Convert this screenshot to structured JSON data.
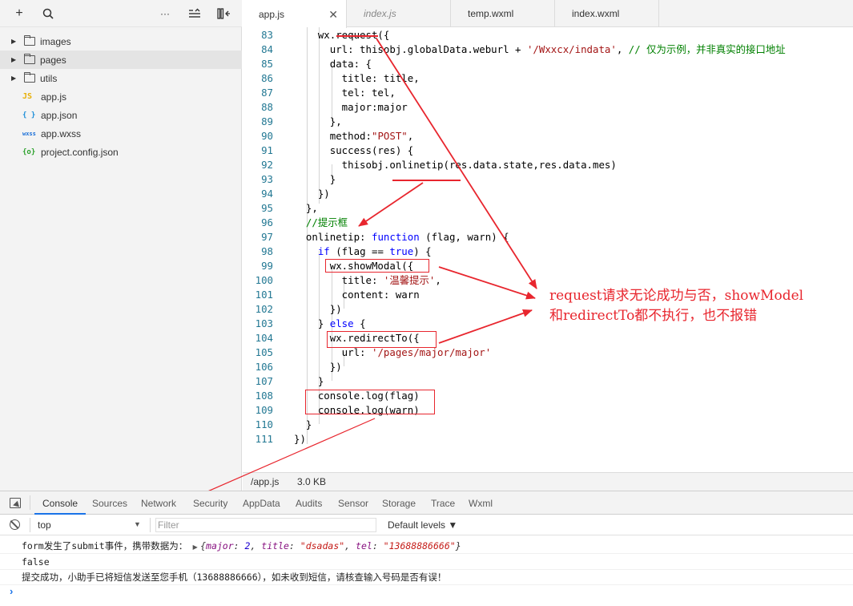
{
  "sidebar": {
    "toolbar": {
      "add_icon": "+",
      "search_icon": "⌕",
      "more_icon": "···"
    },
    "tree": [
      {
        "type": "folder",
        "label": "images"
      },
      {
        "type": "folder",
        "label": "pages"
      },
      {
        "type": "folder",
        "label": "utils"
      },
      {
        "type": "file",
        "icon": "JS",
        "icon_color": "#e8b008",
        "label": "app.js"
      },
      {
        "type": "file",
        "icon": "{ }",
        "icon_color": "#1a8dd8",
        "label": "app.json"
      },
      {
        "type": "file",
        "icon": "wxss",
        "icon_color": "#1a6fd8",
        "label": "app.wxss"
      },
      {
        "type": "file",
        "icon": "{o}",
        "icon_color": "#2aa02a",
        "label": "project.config.json"
      }
    ]
  },
  "editor": {
    "tabs": [
      {
        "label": "app.js",
        "active": true,
        "close": "✕"
      },
      {
        "label": "index.js",
        "active": false
      },
      {
        "label": "temp.wxml",
        "active": false
      },
      {
        "label": "index.wxml",
        "active": false
      }
    ],
    "lines": [
      {
        "n": "83",
        "segs": [
          [
            "    wx.request({",
            ""
          ]
        ]
      },
      {
        "n": "84",
        "segs": [
          [
            "      url: thisobj.globalData.weburl + ",
            ""
          ],
          [
            "'/Wxxcx/indata'",
            "str"
          ],
          [
            ", ",
            ""
          ],
          [
            "// 仅为示例，并非真实的接口地址",
            "cm"
          ]
        ]
      },
      {
        "n": "85",
        "segs": [
          [
            "      data: {",
            ""
          ]
        ]
      },
      {
        "n": "86",
        "segs": [
          [
            "        title: title,",
            ""
          ]
        ]
      },
      {
        "n": "87",
        "segs": [
          [
            "        tel: tel,",
            ""
          ]
        ]
      },
      {
        "n": "88",
        "segs": [
          [
            "        major:major",
            ""
          ]
        ]
      },
      {
        "n": "89",
        "segs": [
          [
            "      },",
            ""
          ]
        ]
      },
      {
        "n": "90",
        "segs": [
          [
            "      method:",
            ""
          ],
          [
            "\"POST\"",
            "str"
          ],
          [
            ",",
            ""
          ]
        ]
      },
      {
        "n": "91",
        "segs": [
          [
            "      success(res) {",
            ""
          ]
        ]
      },
      {
        "n": "92",
        "segs": [
          [
            "        thisobj.onlinetip(res.data.state,res.data.mes)",
            ""
          ]
        ]
      },
      {
        "n": "93",
        "segs": [
          [
            "      }",
            ""
          ]
        ]
      },
      {
        "n": "94",
        "segs": [
          [
            "    })",
            ""
          ]
        ]
      },
      {
        "n": "95",
        "segs": [
          [
            "  },",
            ""
          ]
        ]
      },
      {
        "n": "96",
        "segs": [
          [
            "  //提示框",
            "cm"
          ]
        ]
      },
      {
        "n": "97",
        "segs": [
          [
            "  onlinetip: ",
            ""
          ],
          [
            "function",
            "kw"
          ],
          [
            " (flag, warn) {",
            ""
          ]
        ]
      },
      {
        "n": "98",
        "segs": [
          [
            "    ",
            ""
          ],
          [
            "if",
            "kw"
          ],
          [
            " (flag == ",
            ""
          ],
          [
            "true",
            "kw"
          ],
          [
            ") {",
            ""
          ]
        ]
      },
      {
        "n": "99",
        "segs": [
          [
            "      wx.showModal({",
            ""
          ]
        ]
      },
      {
        "n": "100",
        "segs": [
          [
            "        title: ",
            ""
          ],
          [
            "'温馨提示'",
            "str"
          ],
          [
            ",",
            ""
          ]
        ]
      },
      {
        "n": "101",
        "segs": [
          [
            "        content: warn",
            ""
          ]
        ]
      },
      {
        "n": "102",
        "segs": [
          [
            "      })",
            ""
          ]
        ]
      },
      {
        "n": "103",
        "segs": [
          [
            "    } ",
            ""
          ],
          [
            "else",
            "kw"
          ],
          [
            " {",
            ""
          ]
        ]
      },
      {
        "n": "104",
        "segs": [
          [
            "      wx.redirectTo({",
            ""
          ]
        ]
      },
      {
        "n": "105",
        "segs": [
          [
            "        url: ",
            ""
          ],
          [
            "'/pages/major/major'",
            "str"
          ]
        ]
      },
      {
        "n": "106",
        "segs": [
          [
            "      })",
            ""
          ]
        ]
      },
      {
        "n": "107",
        "segs": [
          [
            "    }",
            ""
          ]
        ]
      },
      {
        "n": "108",
        "segs": [
          [
            "    console.log(flag)",
            ""
          ]
        ]
      },
      {
        "n": "109",
        "segs": [
          [
            "    console.log(warn)",
            ""
          ]
        ]
      },
      {
        "n": "110",
        "segs": [
          [
            "  }",
            ""
          ]
        ]
      },
      {
        "n": "111",
        "segs": [
          [
            "})",
            ""
          ]
        ]
      }
    ],
    "status": {
      "file": "/app.js",
      "size": "3.0 KB"
    }
  },
  "annotation": {
    "text_line1": "request请求无论成功与否，showModel",
    "text_line2": "和redirectTo都不执行，也不报错",
    "color": "#e8262e"
  },
  "devtools": {
    "tabs": [
      "Console",
      "Sources",
      "Network",
      "Security",
      "AppData",
      "Audits",
      "Sensor",
      "Storage",
      "Trace",
      "Wxml"
    ],
    "active_tab": "Console",
    "context": "top",
    "filter_placeholder": "Filter",
    "levels": "Default levels ▼",
    "log1_prefix": "form发生了submit事件，携带数据为：",
    "log1_triangle": "▶",
    "log1_obj": {
      "open": "{",
      "k1": "major",
      "v1": "2",
      "k2": "title",
      "v2": "\"dsadas\"",
      "k3": "tel",
      "v3": "\"13688886666\"",
      "close": "}"
    },
    "log2": "false",
    "log3": "提交成功，小助手已将短信发送至您手机（13688886666），如未收到短信，请核查输入号码是否有误！",
    "prompt": "›"
  }
}
